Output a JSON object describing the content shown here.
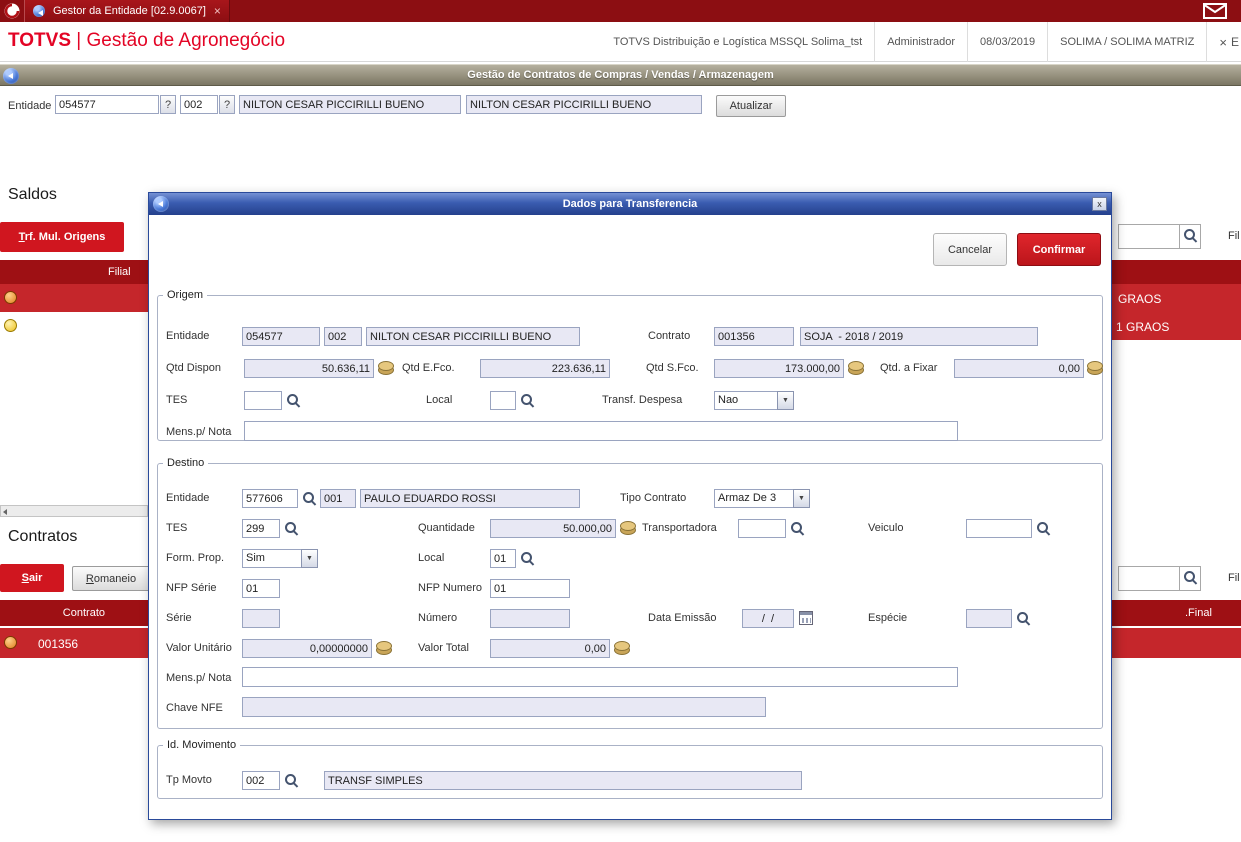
{
  "icons": {
    "dropdown": "▼",
    "tab_close": "×",
    "header_close": "×",
    "window_close": "x"
  },
  "colors": {
    "brand_red": "#e30425",
    "titlebar_red": "#8c0e12",
    "grid_header_red": "#9e1014",
    "grid_row_red": "#c5262b",
    "modal_blue": "#2a4a9a",
    "status_orange": "#e07f1e",
    "status_yellow": "#ecc01e"
  },
  "titlebar": {
    "tab": "Gestor da Entidade [02.9.0067]"
  },
  "header": {
    "brand_name": "TOTVS",
    "brand_sep": "|",
    "brand_module": "Gestão de Agronegócio",
    "environment": "TOTVS Distribuição e Logística MSSQL Solima_tst",
    "user": "Administrador",
    "date": "08/03/2019",
    "company": "SOLIMA / SOLIMA MATRIZ",
    "close_partial": "E"
  },
  "toolbar": {
    "title": "Gestão de Contratos de Compras / Vendas / Armazenagem"
  },
  "entity_bar": {
    "label": "Entidade",
    "code": "054577",
    "help": "?",
    "store": "002",
    "name": "NILTON CESAR PICCIRILLI BUENO",
    "name2": "NILTON CESAR PICCIRILLI BUENO",
    "refresh": "Atualizar"
  },
  "saldos": {
    "title": "Saldos",
    "trf_button": "Trf. Mul. Origens",
    "filter_label": "Fil",
    "header_filial": "Filial",
    "row1_product": "GRAOS",
    "row2_product": "1 GRAOS"
  },
  "contratos": {
    "title": "Contratos",
    "sair_button": "Sair",
    "romaneio_button": "Romaneio",
    "filter_label": "Fil",
    "header_contrato": "Contrato",
    "header_final": ".Final",
    "row_contrato": "001356"
  },
  "modal": {
    "title": "Dados para Transferencia",
    "cancel": "Cancelar",
    "confirm": "Confirmar",
    "origem": {
      "legend": "Origem",
      "entidade_label": "Entidade",
      "entidade": "054577",
      "loja": "002",
      "nome": "NILTON CESAR PICCIRILLI BUENO",
      "contrato_label": "Contrato",
      "contrato": "001356",
      "contrato_desc": "SOJA  - 2018 / 2019",
      "qtd_dispon_label": "Qtd Dispon",
      "qtd_dispon": "50.636,11",
      "qtd_efco_label": "Qtd E.Fco.",
      "qtd_efco": "223.636,11",
      "qtd_sfco_label": "Qtd S.Fco.",
      "qtd_sfco": "173.000,00",
      "qtd_fixar_label": "Qtd. a Fixar",
      "qtd_fixar": "0,00",
      "tes_label": "TES",
      "tes": "",
      "local_label": "Local",
      "local": "",
      "transf_despesa_label": "Transf. Despesa",
      "transf_despesa": "Nao",
      "mens_label": "Mens.p/ Nota",
      "mens": ""
    },
    "destino": {
      "legend": "Destino",
      "entidade_label": "Entidade",
      "entidade": "577606",
      "loja": "001",
      "nome": "PAULO EDUARDO ROSSI",
      "tipo_contrato_label": "Tipo Contrato",
      "tipo_contrato": "Armaz De 3",
      "tes_label": "TES",
      "tes": "299",
      "quantidade_label": "Quantidade",
      "quantidade": "50.000,00",
      "transportadora_label": "Transportadora",
      "transportadora": "",
      "veiculo_label": "Veiculo",
      "veiculo": "",
      "form_prop_label": "Form. Prop.",
      "form_prop": "Sim",
      "local_label": "Local",
      "local": "01",
      "nfp_serie_label": "NFP Série",
      "nfp_serie": "01",
      "nfp_numero_label": "NFP Numero",
      "nfp_numero": "01",
      "serie_label": "Série",
      "serie": "",
      "numero_label": "Número",
      "numero": "",
      "data_emissao_label": "Data Emissão",
      "data_emissao": "/  /",
      "especie_label": "Espécie",
      "especie": "",
      "valor_unitario_label": "Valor Unitário",
      "valor_unitario": "0,00000000",
      "valor_total_label": "Valor Total",
      "valor_total": "0,00",
      "mens_label": "Mens.p/ Nota",
      "mens": "",
      "chave_nfe_label": "Chave NFE",
      "chave_nfe": ""
    },
    "movimento": {
      "legend": "Id. Movimento",
      "tp_movto_label": "Tp Movto",
      "tp_movto": "002",
      "tp_movto_desc": "TRANSF SIMPLES"
    }
  }
}
